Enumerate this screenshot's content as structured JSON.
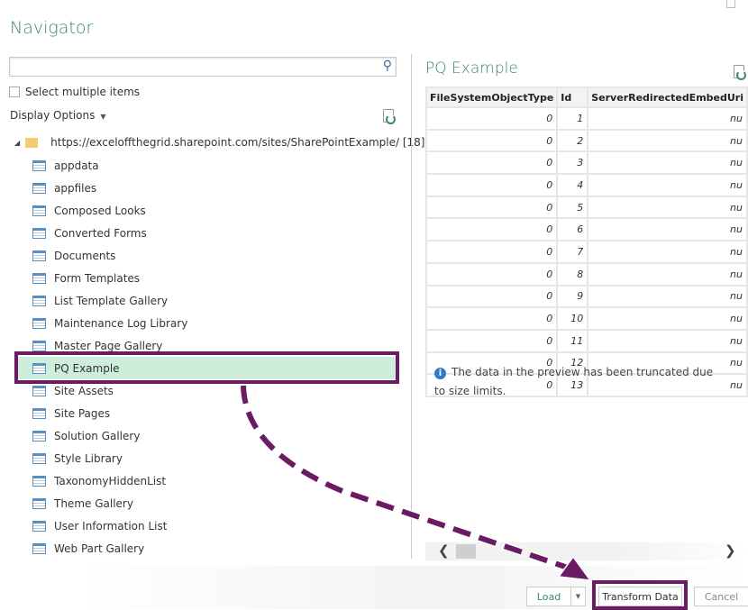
{
  "title": "Navigator",
  "search": {
    "placeholder": "",
    "value": ""
  },
  "select_multiple": "Select multiple items",
  "display_options": "Display Options",
  "root": {
    "label": "https://exceloffthegrid.sharepoint.com/sites/SharePointExample/ [18]"
  },
  "items": [
    {
      "label": "appdata"
    },
    {
      "label": "appfiles"
    },
    {
      "label": "Composed Looks"
    },
    {
      "label": "Converted Forms"
    },
    {
      "label": "Documents"
    },
    {
      "label": "Form Templates"
    },
    {
      "label": "List Template Gallery"
    },
    {
      "label": "Maintenance Log Library"
    },
    {
      "label": "Master Page Gallery"
    },
    {
      "label": "PQ Example",
      "selected": true
    },
    {
      "label": "Site Assets"
    },
    {
      "label": "Site Pages"
    },
    {
      "label": "Solution Gallery"
    },
    {
      "label": "Style Library"
    },
    {
      "label": "TaxonomyHiddenList"
    },
    {
      "label": "Theme Gallery"
    },
    {
      "label": "User Information List"
    },
    {
      "label": "Web Part Gallery"
    }
  ],
  "preview": {
    "title": "PQ Example",
    "columns": [
      "FileSystemObjectType",
      "Id",
      "ServerRedirectedEmbedUri"
    ],
    "rows": [
      [
        "0",
        "1",
        "nu"
      ],
      [
        "0",
        "2",
        "nu"
      ],
      [
        "0",
        "3",
        "nu"
      ],
      [
        "0",
        "4",
        "nu"
      ],
      [
        "0",
        "5",
        "nu"
      ],
      [
        "0",
        "6",
        "nu"
      ],
      [
        "0",
        "7",
        "nu"
      ],
      [
        "0",
        "8",
        "nu"
      ],
      [
        "0",
        "9",
        "nu"
      ],
      [
        "0",
        "10",
        "nu"
      ],
      [
        "0",
        "11",
        "nu"
      ],
      [
        "0",
        "12",
        "nu"
      ],
      [
        "0",
        "13",
        "nu"
      ]
    ],
    "note": "The data in the preview has been truncated due to size limits."
  },
  "buttons": {
    "load": "Load",
    "transform": "Transform Data",
    "cancel": "Cancel"
  },
  "colors": {
    "accent": "#3a8a66",
    "annotation": "#6a1b63",
    "selected": "#cdeedb"
  }
}
